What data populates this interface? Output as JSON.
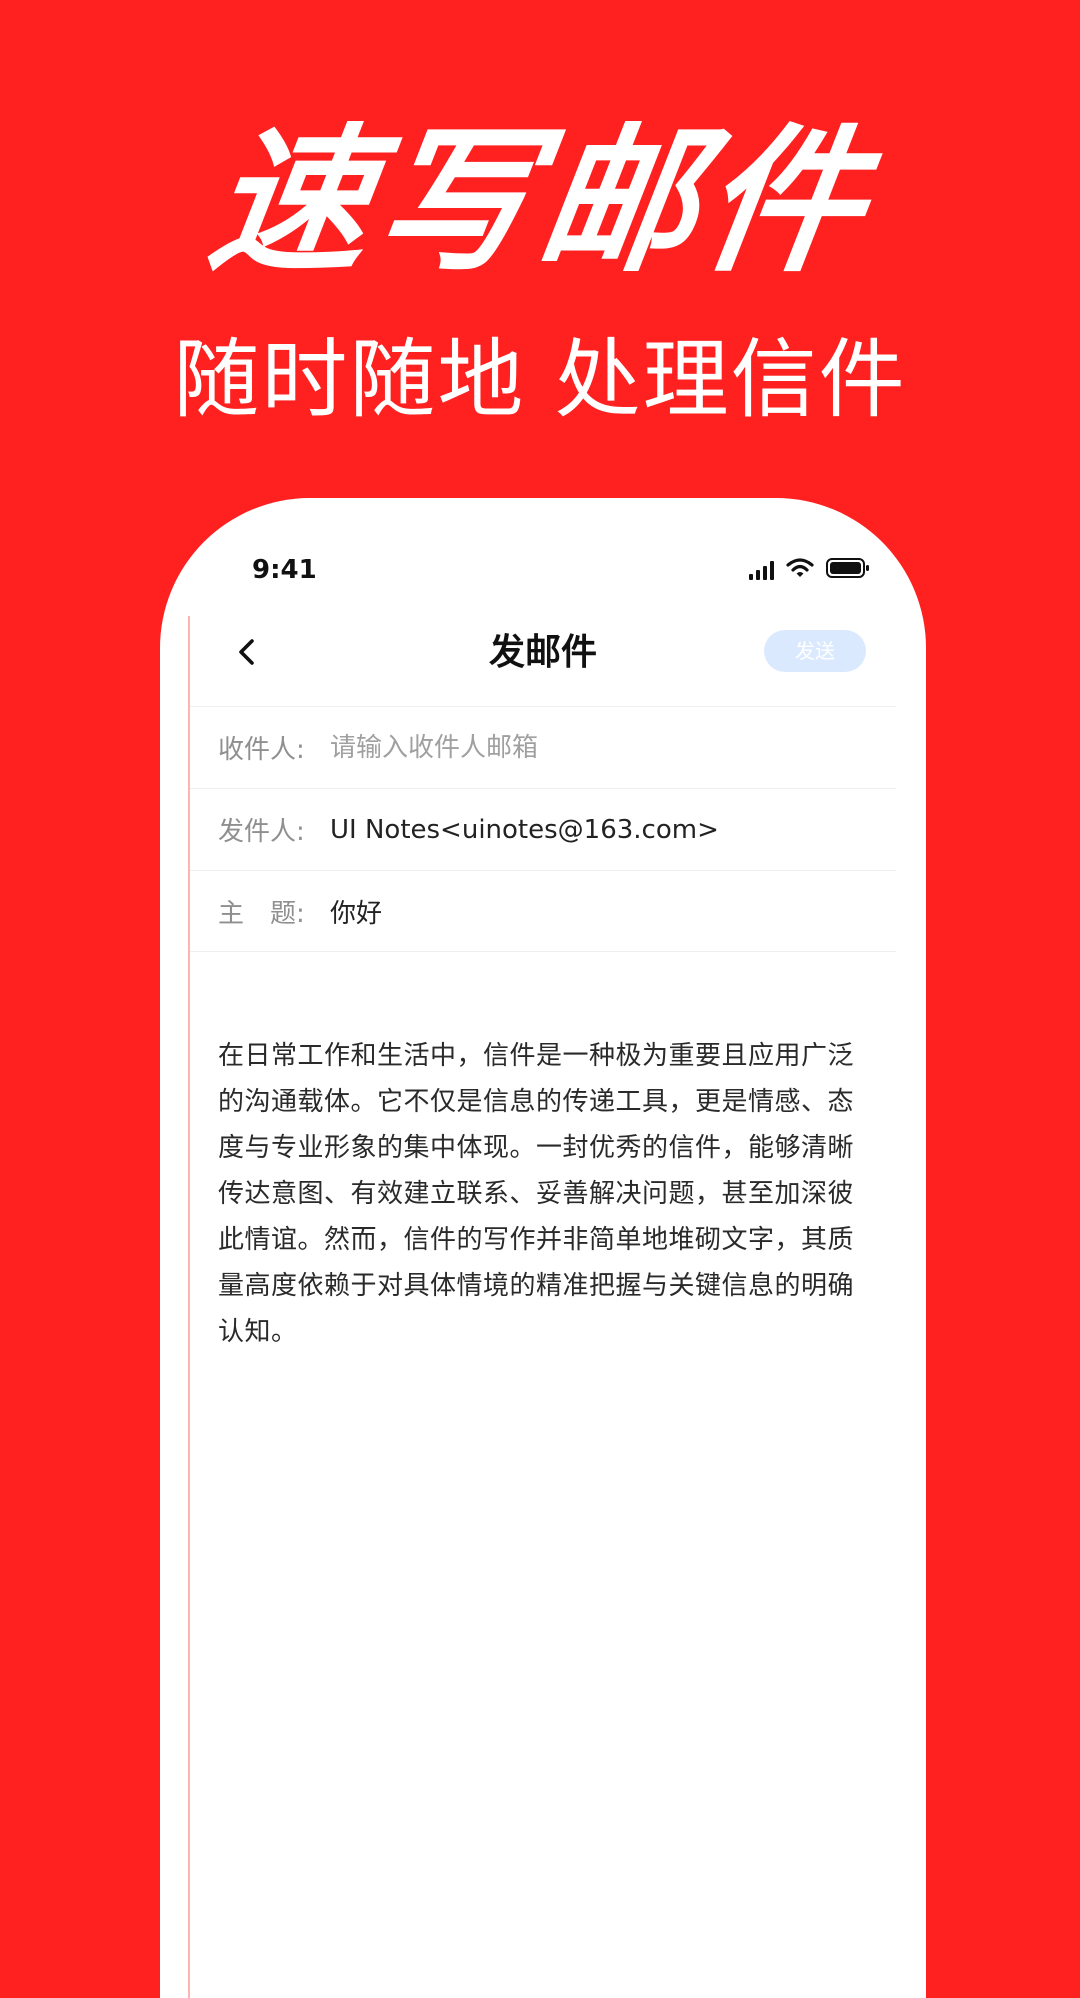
{
  "hero": {
    "title": "速写邮件",
    "subtitle": "随时随地 处理信件"
  },
  "status_bar": {
    "time": "9:41"
  },
  "nav": {
    "title": "发邮件",
    "send_label": "发送"
  },
  "form": {
    "recipient_label": "收件人:",
    "recipient_placeholder": "请输入收件人邮箱",
    "sender_label": "发件人:",
    "sender_value": "UI Notes<uinotes@163.com>",
    "subject_label": "主　题:",
    "subject_value": "你好"
  },
  "body": {
    "text": "在日常工作和生活中，信件是一种极为重要且应用广泛的沟通载体。它不仅是信息的传递工具，更是情感、态度与专业形象的集中体现。一封优秀的信件，能够清晰传达意图、有效建立联系、妥善解决问题，甚至加深彼此情谊。然而，信件的写作并非简单地堆砌文字，其质量高度依赖于对具体情境的精准把握与关键信息的明确认知。"
  },
  "colors": {
    "background": "#ff2020",
    "send_button": "#dbe9ff"
  },
  "icons": {
    "back": "chevron-left-icon",
    "signal": "signal-icon",
    "wifi": "wifi-icon",
    "battery": "battery-icon"
  }
}
